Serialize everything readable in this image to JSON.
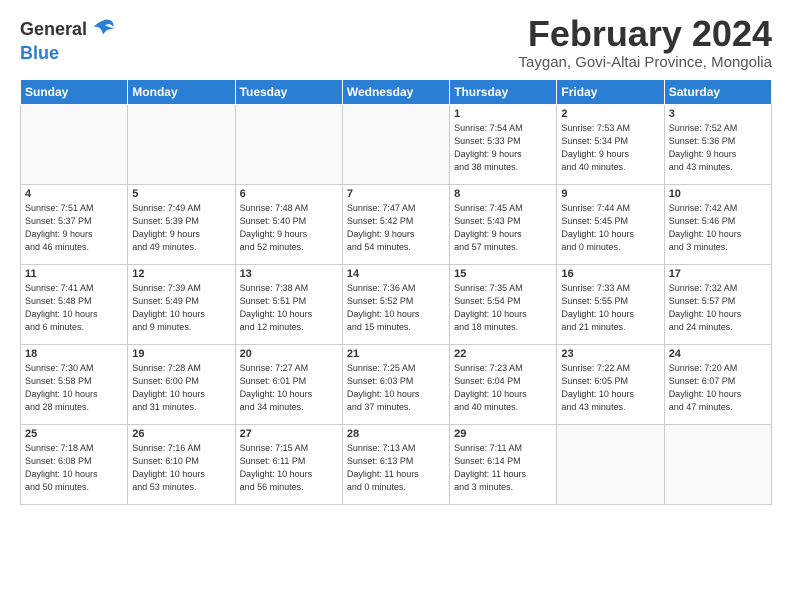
{
  "logo": {
    "line1": "General",
    "line2": "Blue"
  },
  "title": "February 2024",
  "subtitle": "Taygan, Govi-Altai Province, Mongolia",
  "days_of_week": [
    "Sunday",
    "Monday",
    "Tuesday",
    "Wednesday",
    "Thursday",
    "Friday",
    "Saturday"
  ],
  "weeks": [
    [
      {
        "day": "",
        "info": ""
      },
      {
        "day": "",
        "info": ""
      },
      {
        "day": "",
        "info": ""
      },
      {
        "day": "",
        "info": ""
      },
      {
        "day": "1",
        "info": "Sunrise: 7:54 AM\nSunset: 5:33 PM\nDaylight: 9 hours\nand 38 minutes."
      },
      {
        "day": "2",
        "info": "Sunrise: 7:53 AM\nSunset: 5:34 PM\nDaylight: 9 hours\nand 40 minutes."
      },
      {
        "day": "3",
        "info": "Sunrise: 7:52 AM\nSunset: 5:36 PM\nDaylight: 9 hours\nand 43 minutes."
      }
    ],
    [
      {
        "day": "4",
        "info": "Sunrise: 7:51 AM\nSunset: 5:37 PM\nDaylight: 9 hours\nand 46 minutes."
      },
      {
        "day": "5",
        "info": "Sunrise: 7:49 AM\nSunset: 5:39 PM\nDaylight: 9 hours\nand 49 minutes."
      },
      {
        "day": "6",
        "info": "Sunrise: 7:48 AM\nSunset: 5:40 PM\nDaylight: 9 hours\nand 52 minutes."
      },
      {
        "day": "7",
        "info": "Sunrise: 7:47 AM\nSunset: 5:42 PM\nDaylight: 9 hours\nand 54 minutes."
      },
      {
        "day": "8",
        "info": "Sunrise: 7:45 AM\nSunset: 5:43 PM\nDaylight: 9 hours\nand 57 minutes."
      },
      {
        "day": "9",
        "info": "Sunrise: 7:44 AM\nSunset: 5:45 PM\nDaylight: 10 hours\nand 0 minutes."
      },
      {
        "day": "10",
        "info": "Sunrise: 7:42 AM\nSunset: 5:46 PM\nDaylight: 10 hours\nand 3 minutes."
      }
    ],
    [
      {
        "day": "11",
        "info": "Sunrise: 7:41 AM\nSunset: 5:48 PM\nDaylight: 10 hours\nand 6 minutes."
      },
      {
        "day": "12",
        "info": "Sunrise: 7:39 AM\nSunset: 5:49 PM\nDaylight: 10 hours\nand 9 minutes."
      },
      {
        "day": "13",
        "info": "Sunrise: 7:38 AM\nSunset: 5:51 PM\nDaylight: 10 hours\nand 12 minutes."
      },
      {
        "day": "14",
        "info": "Sunrise: 7:36 AM\nSunset: 5:52 PM\nDaylight: 10 hours\nand 15 minutes."
      },
      {
        "day": "15",
        "info": "Sunrise: 7:35 AM\nSunset: 5:54 PM\nDaylight: 10 hours\nand 18 minutes."
      },
      {
        "day": "16",
        "info": "Sunrise: 7:33 AM\nSunset: 5:55 PM\nDaylight: 10 hours\nand 21 minutes."
      },
      {
        "day": "17",
        "info": "Sunrise: 7:32 AM\nSunset: 5:57 PM\nDaylight: 10 hours\nand 24 minutes."
      }
    ],
    [
      {
        "day": "18",
        "info": "Sunrise: 7:30 AM\nSunset: 5:58 PM\nDaylight: 10 hours\nand 28 minutes."
      },
      {
        "day": "19",
        "info": "Sunrise: 7:28 AM\nSunset: 6:00 PM\nDaylight: 10 hours\nand 31 minutes."
      },
      {
        "day": "20",
        "info": "Sunrise: 7:27 AM\nSunset: 6:01 PM\nDaylight: 10 hours\nand 34 minutes."
      },
      {
        "day": "21",
        "info": "Sunrise: 7:25 AM\nSunset: 6:03 PM\nDaylight: 10 hours\nand 37 minutes."
      },
      {
        "day": "22",
        "info": "Sunrise: 7:23 AM\nSunset: 6:04 PM\nDaylight: 10 hours\nand 40 minutes."
      },
      {
        "day": "23",
        "info": "Sunrise: 7:22 AM\nSunset: 6:05 PM\nDaylight: 10 hours\nand 43 minutes."
      },
      {
        "day": "24",
        "info": "Sunrise: 7:20 AM\nSunset: 6:07 PM\nDaylight: 10 hours\nand 47 minutes."
      }
    ],
    [
      {
        "day": "25",
        "info": "Sunrise: 7:18 AM\nSunset: 6:08 PM\nDaylight: 10 hours\nand 50 minutes."
      },
      {
        "day": "26",
        "info": "Sunrise: 7:16 AM\nSunset: 6:10 PM\nDaylight: 10 hours\nand 53 minutes."
      },
      {
        "day": "27",
        "info": "Sunrise: 7:15 AM\nSunset: 6:11 PM\nDaylight: 10 hours\nand 56 minutes."
      },
      {
        "day": "28",
        "info": "Sunrise: 7:13 AM\nSunset: 6:13 PM\nDaylight: 11 hours\nand 0 minutes."
      },
      {
        "day": "29",
        "info": "Sunrise: 7:11 AM\nSunset: 6:14 PM\nDaylight: 11 hours\nand 3 minutes."
      },
      {
        "day": "",
        "info": ""
      },
      {
        "day": "",
        "info": ""
      }
    ]
  ]
}
